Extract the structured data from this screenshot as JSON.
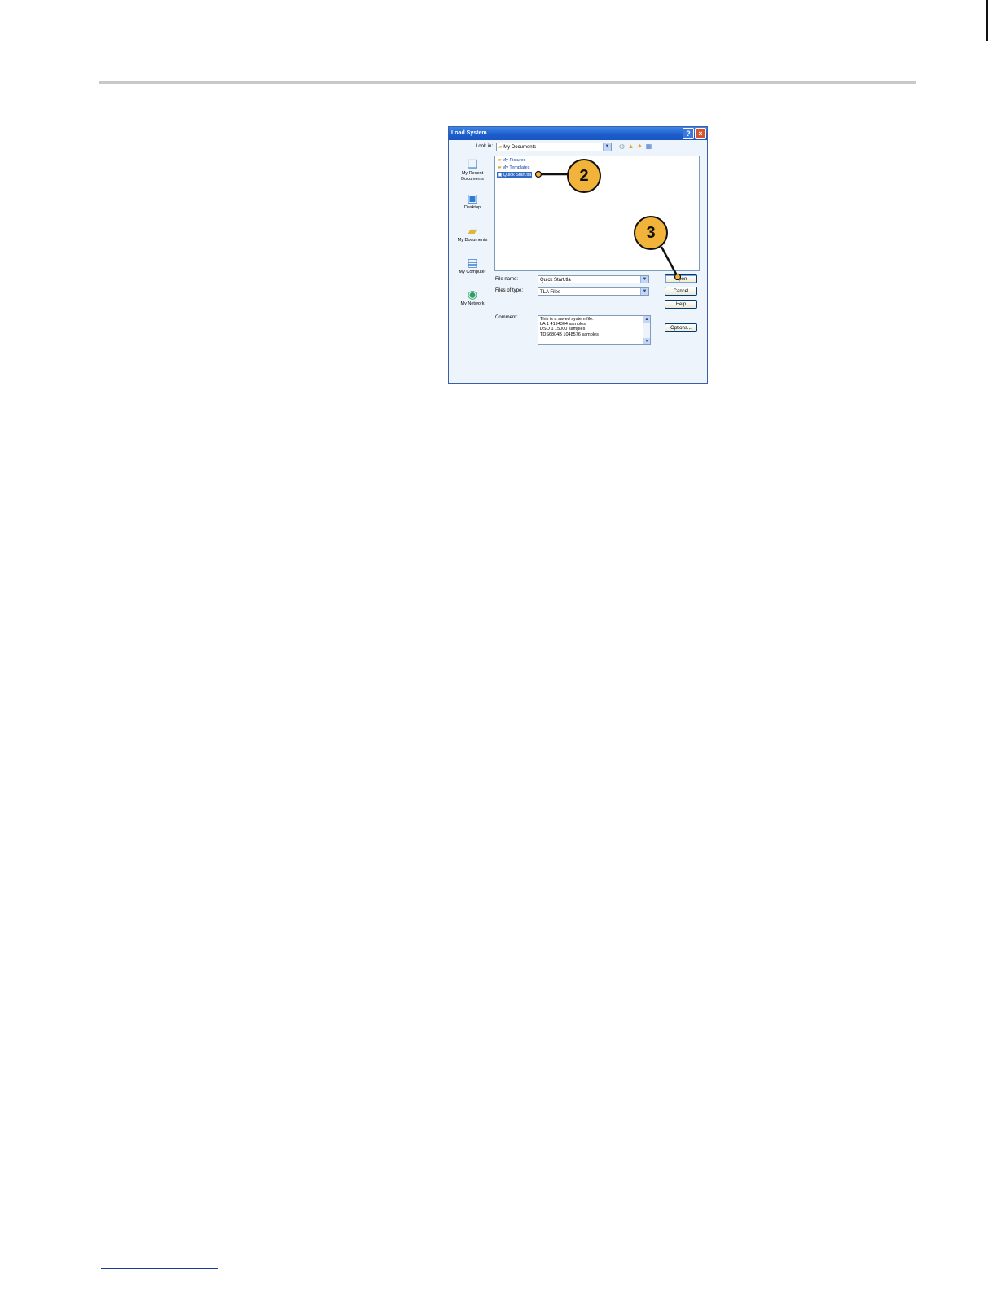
{
  "dialog": {
    "title": "Load System",
    "look_in_label": "Look in:",
    "look_in_value": "My Documents",
    "places": [
      {
        "label": "My Recent Documents",
        "icon": "recent-documents-icon"
      },
      {
        "label": "Desktop",
        "icon": "desktop-icon"
      },
      {
        "label": "My Documents",
        "icon": "my-documents-icon"
      },
      {
        "label": "My Computer",
        "icon": "my-computer-icon"
      },
      {
        "label": "My Network",
        "icon": "my-network-icon"
      }
    ],
    "files": [
      {
        "label": "My Pictures",
        "icon": "folder-icon"
      },
      {
        "label": "My Templates",
        "icon": "folder-icon"
      },
      {
        "label": "Quick Start.tla",
        "icon": "tla-file-icon",
        "selected": true
      }
    ],
    "file_name_label": "File name:",
    "file_name_value": "Quick Start.tla",
    "files_of_type_label": "Files of type:",
    "files_of_type_value": "TLA Files",
    "comment_label": "Comment:",
    "comment_lines": [
      "This is a saved system file.",
      "LA 1   4194304 samples",
      "DSO 1   15000 samples",
      "TDS6804B   1048576 samples"
    ],
    "buttons": {
      "open": "Open",
      "cancel": "Cancel",
      "help": "Help",
      "options": "Options..."
    },
    "title_buttons": {
      "help": "?",
      "close": "×"
    }
  },
  "callouts": [
    {
      "number": "2",
      "target": "Quick Start.tla"
    },
    {
      "number": "3",
      "target": "Open"
    }
  ],
  "colors": {
    "callout_fill": "#f2b33a",
    "titlebar": "#1c5ccc",
    "selection": "#316ac5"
  }
}
